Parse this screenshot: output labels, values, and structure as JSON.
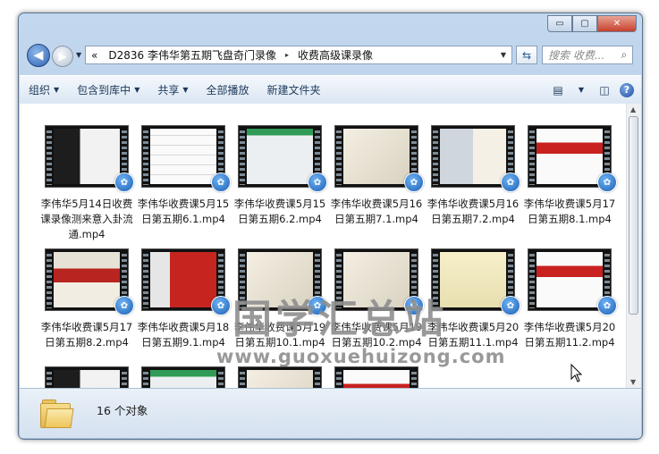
{
  "window": {
    "controls": {
      "minimize": "▭",
      "maximize": "▢",
      "close": "✕"
    }
  },
  "nav": {
    "back_icon": "◀",
    "forward_icon": "▶",
    "history_icon": "▼",
    "breadcrumb_prefix": "«",
    "breadcrumb": [
      "D2836 李伟华第五期飞盘奇门录像",
      "收费高级课录像"
    ],
    "breadcrumb_sep": "▸",
    "address_dropdown": "▼",
    "refresh_icon": "⇆",
    "search_placeholder": "搜索 收费...",
    "search_icon": "⌕"
  },
  "toolbar": {
    "organize": "组织",
    "include_in_library": "包含到库中",
    "share": "共享",
    "play_all": "全部播放",
    "new_folder": "新建文件夹",
    "dropdown_arrow": "▼",
    "view_icon": "▤",
    "preview_pane_icon": "◫",
    "help_icon": "?"
  },
  "files": [
    {
      "name": "李伟华5月14日收费课录像测来意入卦流通.mp4",
      "thumb": "dark"
    },
    {
      "name": "李伟华收费课5月15日第五期6.1.mp4",
      "thumb": "grid"
    },
    {
      "name": "李伟华收费课5月15日第五期6.2.mp4",
      "thumb": "green"
    },
    {
      "name": "李伟华收费课5月16日第五期7.1.mp4",
      "thumb": "paper"
    },
    {
      "name": "李伟华收费课5月16日第五期7.2.mp4",
      "thumb": "split"
    },
    {
      "name": "李伟华收费课5月17日第五期8.1.mp4",
      "thumb": "ink"
    },
    {
      "name": "李伟华收费课5月17日第五期8.2.mp4",
      "thumb": "title"
    },
    {
      "name": "李伟华收费课5月18日第五期9.1.mp4",
      "thumb": "redbar"
    },
    {
      "name": "李伟华收费课5月19日第五期10.1.mp4",
      "thumb": "paper"
    },
    {
      "name": "李伟华收费课5月19日第五期10.2.mp4",
      "thumb": "paper"
    },
    {
      "name": "李伟华收费课5月20日第五期11.1.mp4",
      "thumb": "yellow"
    },
    {
      "name": "李伟华收费课5月20日第五期11.2.mp4",
      "thumb": "ink"
    },
    {
      "name": "",
      "thumb": "dark"
    },
    {
      "name": "",
      "thumb": "green"
    },
    {
      "name": "",
      "thumb": "paper"
    },
    {
      "name": "",
      "thumb": "ink"
    }
  ],
  "badge_icon": "✿",
  "watermark": {
    "line1": "国学汇总站",
    "line2": "www.guoxuehuizong.com"
  },
  "status": {
    "count": "16 个对象"
  },
  "scrollbar": {
    "up": "▲",
    "down": "▼"
  }
}
